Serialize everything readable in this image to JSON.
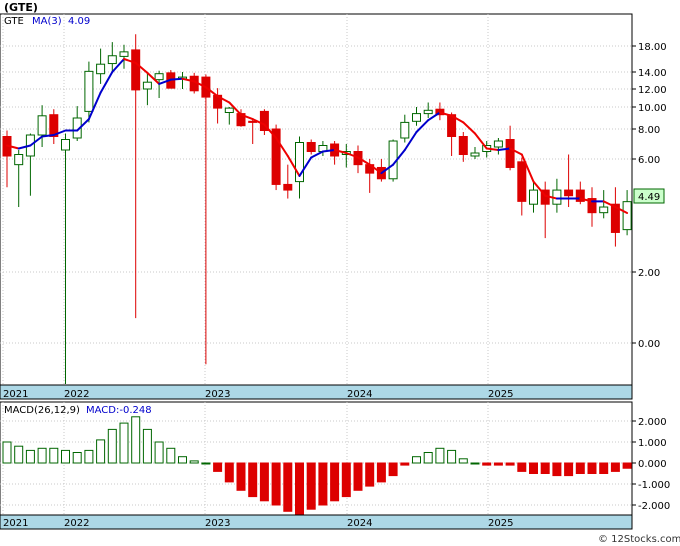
{
  "title": "(GTE)",
  "copyright": "© 12Stocks.com",
  "chart_data": [
    {
      "type": "candlestick",
      "legend": {
        "ticker": "GTE",
        "ma_label": "MA(3)",
        "ma_value": "4.09"
      },
      "last_price_label": "4.49",
      "y_ticks": [
        "18.00",
        "14.00",
        "12.00",
        "10.00",
        "8.00",
        "6.00",
        "2.00",
        "0.00"
      ],
      "x_years": [
        "2021",
        "2022",
        "2023",
        "2024",
        "2025"
      ],
      "colors": {
        "up": "#006600",
        "down": "#dd0000",
        "ma_up": "#0000cc",
        "ma_down": "#ee0000",
        "panel": "#add8e6"
      },
      "candles": [
        {
          "o": 7.5,
          "h": 7.9,
          "l": 5.0,
          "c": 6.2
        },
        {
          "o": 5.8,
          "h": 6.6,
          "l": 4.3,
          "c": 6.3
        },
        {
          "o": 6.2,
          "h": 7.7,
          "l": 4.7,
          "c": 7.6
        },
        {
          "o": 7.6,
          "h": 10.2,
          "l": 6.8,
          "c": 9.2
        },
        {
          "o": 9.3,
          "h": 9.8,
          "l": 7.0,
          "c": 7.5
        },
        {
          "o": 6.6,
          "h": 7.7,
          "l": -2.6,
          "c": 7.3
        },
        {
          "o": 7.4,
          "h": 10.1,
          "l": 7.2,
          "c": 9.0
        },
        {
          "o": 9.6,
          "h": 15.6,
          "l": 8.6,
          "c": 14.1
        },
        {
          "o": 13.8,
          "h": 17.6,
          "l": 12.6,
          "c": 15.2
        },
        {
          "o": 15.3,
          "h": 18.6,
          "l": 14.0,
          "c": 16.5
        },
        {
          "o": 16.4,
          "h": 18.2,
          "l": 14.5,
          "c": 17.1
        },
        {
          "o": 17.4,
          "h": 19.8,
          "l": 0.7,
          "c": 11.9
        },
        {
          "o": 12.0,
          "h": 13.8,
          "l": 10.2,
          "c": 12.8
        },
        {
          "o": 13.1,
          "h": 14.2,
          "l": 11.0,
          "c": 13.8
        },
        {
          "o": 13.9,
          "h": 14.3,
          "l": 12.3,
          "c": 12.1
        },
        {
          "o": 13.2,
          "h": 14.0,
          "l": 12.0,
          "c": 13.4
        },
        {
          "o": 13.5,
          "h": 13.9,
          "l": 11.5,
          "c": 11.8
        },
        {
          "o": 13.4,
          "h": 13.7,
          "l": -0.6,
          "c": 11.1
        },
        {
          "o": 11.3,
          "h": 12.1,
          "l": 8.5,
          "c": 9.9
        },
        {
          "o": 9.5,
          "h": 10.0,
          "l": 8.4,
          "c": 9.9
        },
        {
          "o": 9.4,
          "h": 9.8,
          "l": 8.2,
          "c": 8.3
        },
        {
          "o": 8.7,
          "h": 9.0,
          "l": 7.0,
          "c": 8.6
        },
        {
          "o": 9.6,
          "h": 9.8,
          "l": 7.6,
          "c": 7.9
        },
        {
          "o": 8.0,
          "h": 8.4,
          "l": 4.9,
          "c": 5.1
        },
        {
          "o": 5.1,
          "h": 5.8,
          "l": 4.6,
          "c": 4.9
        },
        {
          "o": 5.2,
          "h": 7.5,
          "l": 4.6,
          "c": 7.1
        },
        {
          "o": 7.1,
          "h": 7.3,
          "l": 6.3,
          "c": 6.5
        },
        {
          "o": 6.5,
          "h": 7.2,
          "l": 6.2,
          "c": 6.9
        },
        {
          "o": 7.0,
          "h": 7.2,
          "l": 5.8,
          "c": 6.2
        },
        {
          "o": 6.3,
          "h": 7.0,
          "l": 5.7,
          "c": 6.5
        },
        {
          "o": 6.5,
          "h": 6.9,
          "l": 5.5,
          "c": 5.8
        },
        {
          "o": 5.8,
          "h": 6.0,
          "l": 4.8,
          "c": 5.5
        },
        {
          "o": 5.7,
          "h": 6.0,
          "l": 5.2,
          "c": 5.3
        },
        {
          "o": 5.3,
          "h": 7.3,
          "l": 5.2,
          "c": 7.2
        },
        {
          "o": 7.4,
          "h": 9.3,
          "l": 7.1,
          "c": 8.6
        },
        {
          "o": 8.7,
          "h": 10.0,
          "l": 8.3,
          "c": 9.4
        },
        {
          "o": 9.4,
          "h": 10.5,
          "l": 9.0,
          "c": 9.7
        },
        {
          "o": 9.8,
          "h": 10.5,
          "l": 8.8,
          "c": 9.3
        },
        {
          "o": 9.3,
          "h": 9.5,
          "l": 6.2,
          "c": 7.5
        },
        {
          "o": 7.5,
          "h": 7.8,
          "l": 5.9,
          "c": 6.3
        },
        {
          "o": 6.2,
          "h": 6.8,
          "l": 6.0,
          "c": 6.4
        },
        {
          "o": 6.5,
          "h": 7.2,
          "l": 6.1,
          "c": 6.9
        },
        {
          "o": 6.8,
          "h": 7.4,
          "l": 6.3,
          "c": 7.2
        },
        {
          "o": 7.3,
          "h": 8.3,
          "l": 5.6,
          "c": 5.7
        },
        {
          "o": 5.9,
          "h": 6.1,
          "l": 4.0,
          "c": 4.5
        },
        {
          "o": 4.4,
          "h": 5.2,
          "l": 4.1,
          "c": 4.9
        },
        {
          "o": 4.9,
          "h": 5.2,
          "l": 3.2,
          "c": 4.4
        },
        {
          "o": 4.4,
          "h": 5.3,
          "l": 4.1,
          "c": 4.9
        },
        {
          "o": 4.9,
          "h": 6.3,
          "l": 4.3,
          "c": 4.7
        },
        {
          "o": 4.9,
          "h": 5.2,
          "l": 4.4,
          "c": 4.5
        },
        {
          "o": 4.6,
          "h": 5.0,
          "l": 3.6,
          "c": 4.1
        },
        {
          "o": 4.1,
          "h": 4.9,
          "l": 3.9,
          "c": 4.3
        },
        {
          "o": 4.4,
          "h": 5.0,
          "l": 2.9,
          "c": 3.4
        },
        {
          "o": 3.5,
          "h": 4.9,
          "l": 3.3,
          "c": 4.49
        }
      ],
      "ma": [
        6.9,
        6.7,
        6.9,
        7.5,
        7.6,
        7.9,
        7.9,
        8.9,
        11.6,
        14.0,
        16.0,
        15.4,
        13.9,
        12.6,
        13.1,
        13.2,
        12.9,
        12.2,
        11.2,
        10.5,
        9.3,
        8.9,
        8.4,
        7.4,
        6.2,
        5.4,
        6.1,
        6.5,
        6.6,
        6.4,
        6.1,
        5.8,
        5.5,
        5.8,
        6.6,
        7.8,
        8.8,
        9.5,
        9.2,
        8.6,
        7.7,
        6.7,
        6.6,
        6.7,
        6.3,
        5.2,
        4.7,
        4.6,
        4.6,
        4.6,
        4.5,
        4.5,
        4.3,
        4.09
      ]
    },
    {
      "type": "bar",
      "legend": {
        "label": "MACD(26,12,9)",
        "value_label": "MACD:-0.248"
      },
      "y_ticks": [
        "2.000",
        "1.000",
        "0.000",
        "-1.000",
        "-2.000"
      ],
      "x_years": [
        "2021",
        "2022",
        "2023",
        "2024",
        "2025"
      ],
      "values": [
        1.0,
        0.8,
        0.6,
        0.7,
        0.7,
        0.6,
        0.5,
        0.6,
        1.1,
        1.6,
        1.9,
        2.2,
        1.6,
        1.0,
        0.7,
        0.3,
        0.1,
        0.0,
        -0.4,
        -0.9,
        -1.3,
        -1.6,
        -1.8,
        -2.0,
        -2.3,
        -2.5,
        -2.2,
        -2.0,
        -1.8,
        -1.6,
        -1.3,
        -1.1,
        -0.9,
        -0.6,
        -0.1,
        0.3,
        0.5,
        0.7,
        0.6,
        0.2,
        0.0,
        -0.1,
        -0.1,
        -0.1,
        -0.4,
        -0.5,
        -0.5,
        -0.6,
        -0.6,
        -0.5,
        -0.5,
        -0.5,
        -0.4,
        -0.25
      ]
    }
  ]
}
